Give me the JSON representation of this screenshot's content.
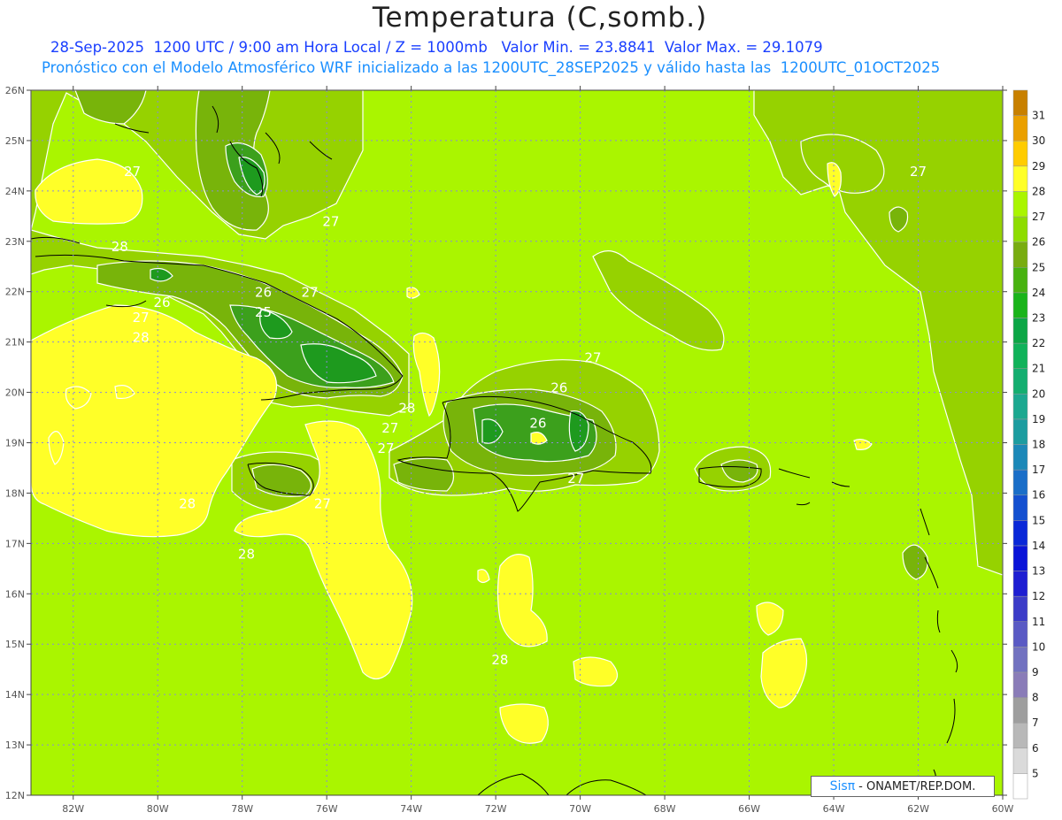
{
  "header": {
    "title": "Temperatura (C,somb.)",
    "subtitle1": "28-Sep-2025  1200 UTC / 9:00 am Hora Local / Z = 1000mb   Valor Min. = 23.8841  Valor Max. = 29.1079",
    "subtitle2": "Pronóstico con el Modelo Atmosférico WRF inicializado a las 1200UTC_28SEP2025 y válido hasta las  1200UTC_01OCT2025"
  },
  "credit": {
    "logo": "Sisπ",
    "org": "- ONAMET/REP.DOM."
  },
  "map": {
    "lon_range": [
      -83,
      -60
    ],
    "lat_range": [
      12,
      26
    ],
    "lat_ticks": [
      "12N",
      "13N",
      "14N",
      "15N",
      "16N",
      "17N",
      "18N",
      "19N",
      "20N",
      "21N",
      "22N",
      "23N",
      "24N",
      "25N",
      "26N"
    ],
    "lon_ticks": [
      "82W",
      "80W",
      "78W",
      "76W",
      "74W",
      "72W",
      "70W",
      "68W",
      "66W",
      "64W",
      "62W",
      "60W"
    ],
    "contour_labels": [
      {
        "text": "27",
        "lon": -80.6,
        "lat": 24.3
      },
      {
        "text": "28",
        "lon": -80.9,
        "lat": 22.8
      },
      {
        "text": "27",
        "lon": -75.9,
        "lat": 23.3
      },
      {
        "text": "26",
        "lon": -77.5,
        "lat": 21.9
      },
      {
        "text": "27",
        "lon": -76.4,
        "lat": 21.9
      },
      {
        "text": "26",
        "lon": -79.9,
        "lat": 21.7
      },
      {
        "text": "25",
        "lon": -77.5,
        "lat": 21.5
      },
      {
        "text": "27",
        "lon": -80.4,
        "lat": 21.4
      },
      {
        "text": "28",
        "lon": -80.4,
        "lat": 21.0
      },
      {
        "text": "27",
        "lon": -69.7,
        "lat": 20.6
      },
      {
        "text": "26",
        "lon": -70.5,
        "lat": 20.0
      },
      {
        "text": "28",
        "lon": -74.1,
        "lat": 19.6
      },
      {
        "text": "26",
        "lon": -71.0,
        "lat": 19.3
      },
      {
        "text": "27",
        "lon": -74.5,
        "lat": 19.2
      },
      {
        "text": "27",
        "lon": -74.6,
        "lat": 18.8
      },
      {
        "text": "27",
        "lon": -70.1,
        "lat": 18.2
      },
      {
        "text": "27",
        "lon": -76.1,
        "lat": 17.7
      },
      {
        "text": "28",
        "lon": -79.3,
        "lat": 17.7
      },
      {
        "text": "28",
        "lon": -77.9,
        "lat": 16.7
      },
      {
        "text": "28",
        "lon": -71.9,
        "lat": 14.6
      },
      {
        "text": "27",
        "lon": -62.0,
        "lat": 24.3
      }
    ]
  },
  "colorbar": {
    "levels": [
      "5",
      "6",
      "7",
      "8",
      "9",
      "10",
      "11",
      "12",
      "13",
      "14",
      "15",
      "16",
      "17",
      "18",
      "19",
      "20",
      "21",
      "22",
      "23",
      "24",
      "25",
      "26",
      "27",
      "28",
      "29",
      "30",
      "31"
    ],
    "colors": [
      "#ffffff",
      "#dadada",
      "#b8b8b8",
      "#9e9e9e",
      "#8a7cb8",
      "#7272c0",
      "#5a5ac4",
      "#3c3cc8",
      "#1e1ed2",
      "#0a14d8",
      "#0a28d8",
      "#1450d0",
      "#1a6ec8",
      "#1c88b8",
      "#1c9ca0",
      "#1ca890",
      "#14ae70",
      "#10b25a",
      "#0ca646",
      "#1ab41a",
      "#48b210",
      "#78ac10",
      "#8edc00",
      "#aaf500",
      "#ffff28",
      "#ffcc00",
      "#eaa000",
      "#c88000"
    ]
  },
  "colors": {
    "t25_26": "#3ca01c",
    "t24_25": "#1e9a1e",
    "t26_27": "#78b40a",
    "t27_28": "#96d200",
    "t28_29": "#aaf500",
    "t29_30": "#ffff28"
  }
}
